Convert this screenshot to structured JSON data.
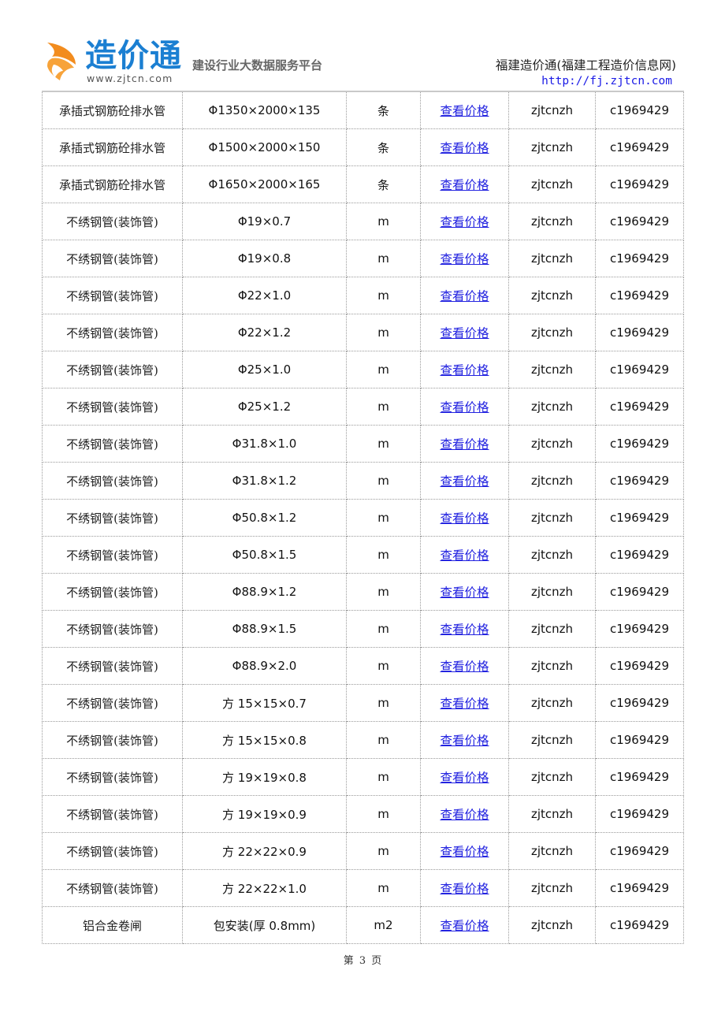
{
  "header": {
    "logo": {
      "name": "造价通",
      "url": "www.zjtcn.com",
      "brand_color": "#1b7fd2",
      "accent_color": "#f28c1e"
    },
    "slogan": "建设行业大数据服务平台",
    "site_title": "福建造价通(福建工程造价信息网)",
    "site_url": "http://fj.zjtcn.com"
  },
  "table": {
    "rows": [
      {
        "name": "承插式钢筋砼排水管",
        "spec": "Φ1350×2000×135",
        "unit": "条",
        "link": "查看价格",
        "user": "zjtcnzh",
        "code": "c1969429"
      },
      {
        "name": "承插式钢筋砼排水管",
        "spec": "Φ1500×2000×150",
        "unit": "条",
        "link": "查看价格",
        "user": "zjtcnzh",
        "code": "c1969429"
      },
      {
        "name": "承插式钢筋砼排水管",
        "spec": "Φ1650×2000×165",
        "unit": "条",
        "link": "查看价格",
        "user": "zjtcnzh",
        "code": "c1969429"
      },
      {
        "name": "不绣钢管(装饰管)",
        "spec": "Φ19×0.7",
        "unit": "m",
        "link": "查看价格",
        "user": "zjtcnzh",
        "code": "c1969429"
      },
      {
        "name": "不绣钢管(装饰管)",
        "spec": "Φ19×0.8",
        "unit": "m",
        "link": "查看价格",
        "user": "zjtcnzh",
        "code": "c1969429"
      },
      {
        "name": "不绣钢管(装饰管)",
        "spec": "Φ22×1.0",
        "unit": "m",
        "link": "查看价格",
        "user": "zjtcnzh",
        "code": "c1969429"
      },
      {
        "name": "不绣钢管(装饰管)",
        "spec": "Φ22×1.2",
        "unit": "m",
        "link": "查看价格",
        "user": "zjtcnzh",
        "code": "c1969429"
      },
      {
        "name": "不绣钢管(装饰管)",
        "spec": "Φ25×1.0",
        "unit": "m",
        "link": "查看价格",
        "user": "zjtcnzh",
        "code": "c1969429"
      },
      {
        "name": "不绣钢管(装饰管)",
        "spec": "Φ25×1.2",
        "unit": "m",
        "link": "查看价格",
        "user": "zjtcnzh",
        "code": "c1969429"
      },
      {
        "name": "不绣钢管(装饰管)",
        "spec": "Φ31.8×1.0",
        "unit": "m",
        "link": "查看价格",
        "user": "zjtcnzh",
        "code": "c1969429"
      },
      {
        "name": "不绣钢管(装饰管)",
        "spec": "Φ31.8×1.2",
        "unit": "m",
        "link": "查看价格",
        "user": "zjtcnzh",
        "code": "c1969429"
      },
      {
        "name": "不绣钢管(装饰管)",
        "spec": "Φ50.8×1.2",
        "unit": "m",
        "link": "查看价格",
        "user": "zjtcnzh",
        "code": "c1969429"
      },
      {
        "name": "不绣钢管(装饰管)",
        "spec": "Φ50.8×1.5",
        "unit": "m",
        "link": "查看价格",
        "user": "zjtcnzh",
        "code": "c1969429"
      },
      {
        "name": "不绣钢管(装饰管)",
        "spec": "Φ88.9×1.2",
        "unit": "m",
        "link": "查看价格",
        "user": "zjtcnzh",
        "code": "c1969429"
      },
      {
        "name": "不绣钢管(装饰管)",
        "spec": "Φ88.9×1.5",
        "unit": "m",
        "link": "查看价格",
        "user": "zjtcnzh",
        "code": "c1969429"
      },
      {
        "name": "不绣钢管(装饰管)",
        "spec": "Φ88.9×2.0",
        "unit": "m",
        "link": "查看价格",
        "user": "zjtcnzh",
        "code": "c1969429"
      },
      {
        "name": "不绣钢管(装饰管)",
        "spec": "方 15×15×0.7",
        "unit": "m",
        "link": "查看价格",
        "user": "zjtcnzh",
        "code": "c1969429"
      },
      {
        "name": "不绣钢管(装饰管)",
        "spec": "方 15×15×0.8",
        "unit": "m",
        "link": "查看价格",
        "user": "zjtcnzh",
        "code": "c1969429"
      },
      {
        "name": "不绣钢管(装饰管)",
        "spec": "方 19×19×0.8",
        "unit": "m",
        "link": "查看价格",
        "user": "zjtcnzh",
        "code": "c1969429"
      },
      {
        "name": "不绣钢管(装饰管)",
        "spec": "方 19×19×0.9",
        "unit": "m",
        "link": "查看价格",
        "user": "zjtcnzh",
        "code": "c1969429"
      },
      {
        "name": "不绣钢管(装饰管)",
        "spec": "方 22×22×0.9",
        "unit": "m",
        "link": "查看价格",
        "user": "zjtcnzh",
        "code": "c1969429"
      },
      {
        "name": "不绣钢管(装饰管)",
        "spec": "方 22×22×1.0",
        "unit": "m",
        "link": "查看价格",
        "user": "zjtcnzh",
        "code": "c1969429"
      },
      {
        "name": "铝合金卷闸",
        "spec": "包安装(厚 0.8mm)",
        "unit": "m2",
        "link": "查看价格",
        "user": "zjtcnzh",
        "code": "c1969429"
      }
    ]
  },
  "footer": {
    "page_label": "第 3 页"
  }
}
